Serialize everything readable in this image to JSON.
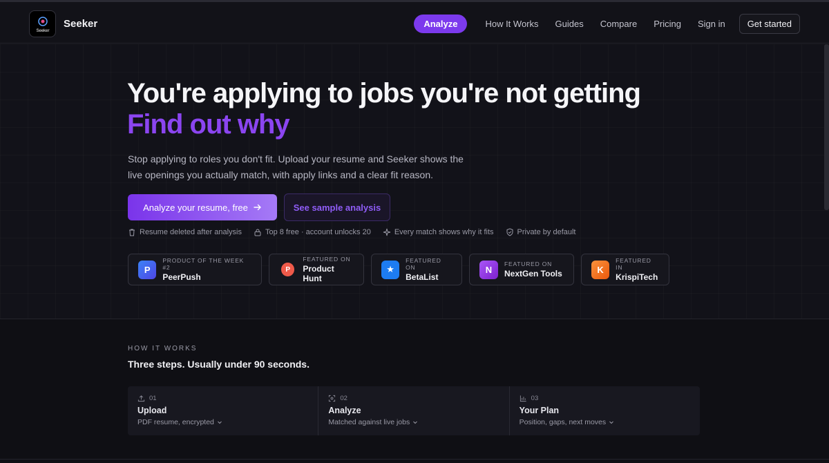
{
  "nav": {
    "brand": "Seeker",
    "logo_text": "Seeker",
    "links": {
      "analyze": "Analyze",
      "how_it_works": "How It Works",
      "guides": "Guides",
      "compare": "Compare",
      "pricing": "Pricing",
      "sign_in": "Sign in",
      "get_started": "Get started"
    }
  },
  "hero": {
    "headline": "You're applying to jobs you're not getting",
    "headline_accent": "Find out why",
    "subtitle": "Stop applying to roles you don't fit. Upload your resume and Seeker shows the live openings you actually match, with apply links and a clear fit reason.",
    "primary_cta": "Analyze your resume, free",
    "secondary_cta": "See sample analysis",
    "trust": [
      {
        "icon": "trash-icon",
        "text": "Resume deleted after analysis"
      },
      {
        "icon": "lock-icon",
        "text": "Top 8 free · account unlocks 20"
      },
      {
        "icon": "sparkle-icon",
        "text": "Every match shows why it fits"
      },
      {
        "icon": "shield-icon",
        "text": "Private by default"
      }
    ],
    "badges": [
      {
        "letter": "P",
        "kicker": "Product of the week #2",
        "name": "PeerPush",
        "color": "#2563eb"
      },
      {
        "letter": "P",
        "kicker": "Featured on",
        "name": "Product Hunt",
        "color": "#ef5a4a"
      },
      {
        "letter": "★",
        "kicker": "Featured on",
        "name": "BetaList",
        "color": "#1d7cf2"
      },
      {
        "letter": "N",
        "kicker": "Featured on",
        "name": "NextGen Tools",
        "color": "#9333ea"
      },
      {
        "letter": "K",
        "kicker": "Featured in",
        "name": "KrispiTech",
        "color": "#f97316"
      }
    ]
  },
  "how": {
    "kicker": "HOW IT WORKS",
    "title": "Three steps. Usually under 90 seconds.",
    "steps": [
      {
        "num": "01",
        "icon": "upload-icon",
        "name": "Upload",
        "desc": "PDF resume, encrypted"
      },
      {
        "num": "02",
        "icon": "scan-icon",
        "name": "Analyze",
        "desc": "Matched against live jobs"
      },
      {
        "num": "03",
        "icon": "bar-chart-icon",
        "name": "Your Plan",
        "desc": "Position, gaps, next moves"
      }
    ]
  },
  "colors": {
    "accent": "#7c3aed",
    "accent_text": "#8b45f0",
    "background": "#0e0e14"
  }
}
